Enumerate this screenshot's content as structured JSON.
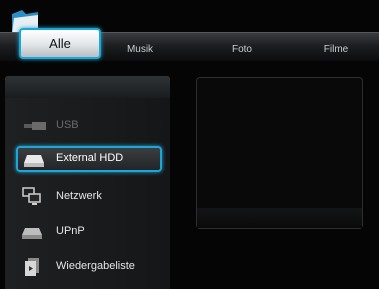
{
  "tabs": [
    {
      "label": "Alle",
      "active": true
    },
    {
      "label": "Musik",
      "active": false
    },
    {
      "label": "Foto",
      "active": false
    },
    {
      "label": "Filme",
      "active": false
    }
  ],
  "sidebar": {
    "items": [
      {
        "label": "USB",
        "icon": "usb-icon",
        "state": "disabled"
      },
      {
        "label": "External HDD",
        "icon": "hdd-icon",
        "state": "selected"
      },
      {
        "label": "Netzwerk",
        "icon": "network-icon",
        "state": "normal"
      },
      {
        "label": "UPnP",
        "icon": "upnp-drive-icon",
        "state": "normal"
      },
      {
        "label": "Wiedergabeliste",
        "icon": "playlist-icon",
        "state": "normal"
      }
    ]
  },
  "colors": {
    "accent": "#1fa6d8",
    "background": "#050505"
  }
}
